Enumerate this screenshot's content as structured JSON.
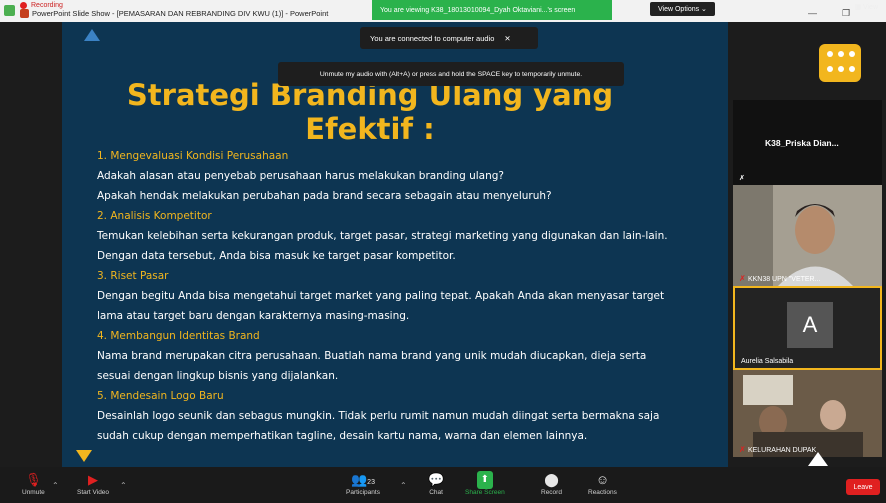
{
  "titlebar": {
    "recording_label": "Recording",
    "window_title": "PowerPoint Slide Show - [PEMASARAN DAN REBRANDING DIV KWU (1)] - PowerPoint",
    "viewing_banner": "You are viewing K38_18013010094_Dyah Oktaviani...'s screen",
    "view_options": "View Options ⌄",
    "view_label": "View"
  },
  "audio_tip": "You are connected to computer audio",
  "unmute_tip": "Unmute my audio with (Alt+A) or press and hold the SPACE key to temporarily unmute.",
  "slide": {
    "title_line1": "Strategi Branding Ulang yang",
    "title_line2": "Efektif :",
    "lines": [
      {
        "kind": "h",
        "text": "1. Mengevaluasi Kondisi Perusahaan"
      },
      {
        "kind": "p",
        "text": "Adakah alasan atau penyebab perusahaan harus melakukan branding ulang?"
      },
      {
        "kind": "p",
        "text": "Apakah hendak melakukan perubahan pada brand secara sebagain atau menyeluruh?"
      },
      {
        "kind": "h",
        "text": "2. Analisis Kompetitor"
      },
      {
        "kind": "p",
        "text": "Temukan kelebihan serta kekurangan produk, target pasar, strategi marketing yang digunakan dan lain-lain."
      },
      {
        "kind": "p",
        "text": "Dengan data tersebut, Anda bisa masuk ke target pasar kompetitor."
      },
      {
        "kind": "h",
        "text": "3. Riset Pasar"
      },
      {
        "kind": "p",
        "text": "Dengan begitu Anda bisa mengetahui target market yang paling tepat. Apakah Anda akan menyasar target"
      },
      {
        "kind": "p",
        "text": "lama atau target baru dengan karakternya masing-masing."
      },
      {
        "kind": "h",
        "text": "4. Membangun Identitas Brand"
      },
      {
        "kind": "p",
        "text": "Nama brand merupakan citra perusahaan. Buatlah nama brand yang unik mudah diucapkan, dieja serta"
      },
      {
        "kind": "p",
        "text": "sesuai dengan lingkup bisnis yang dijalankan."
      },
      {
        "kind": "h",
        "text": "5. Mendesain Logo Baru"
      },
      {
        "kind": "p",
        "text": "Desainlah logo seunik dan sebagus mungkin. Tidak perlu rumit namun mudah diingat serta bermakna saja"
      },
      {
        "kind": "p",
        "text": "sudah cukup dengan memperhatikan tagline, desain kartu nama, warna dan elemen lainnya."
      }
    ]
  },
  "gallery": {
    "tile1_name": "K38_Priska  Dian...",
    "tile2_name": "KKN38 UPN \"VETER...",
    "tile3_avatar": "A",
    "tile3_name": "Aurelia Salsabila",
    "tile4_name": "KELURAHAN DUPAK"
  },
  "toolbar": {
    "unmute": "Unmute",
    "start_video": "Start Video",
    "participants": "Participants",
    "participants_count": "23",
    "chat": "Chat",
    "share_screen": "Share Screen",
    "record": "Record",
    "reactions": "Reactions",
    "leave": "Leave"
  },
  "colors": {
    "slide_bg": "#0d3552",
    "accent_yellow": "#f2b61e",
    "zoom_green": "#2bb24c",
    "leave_red": "#e02020"
  }
}
